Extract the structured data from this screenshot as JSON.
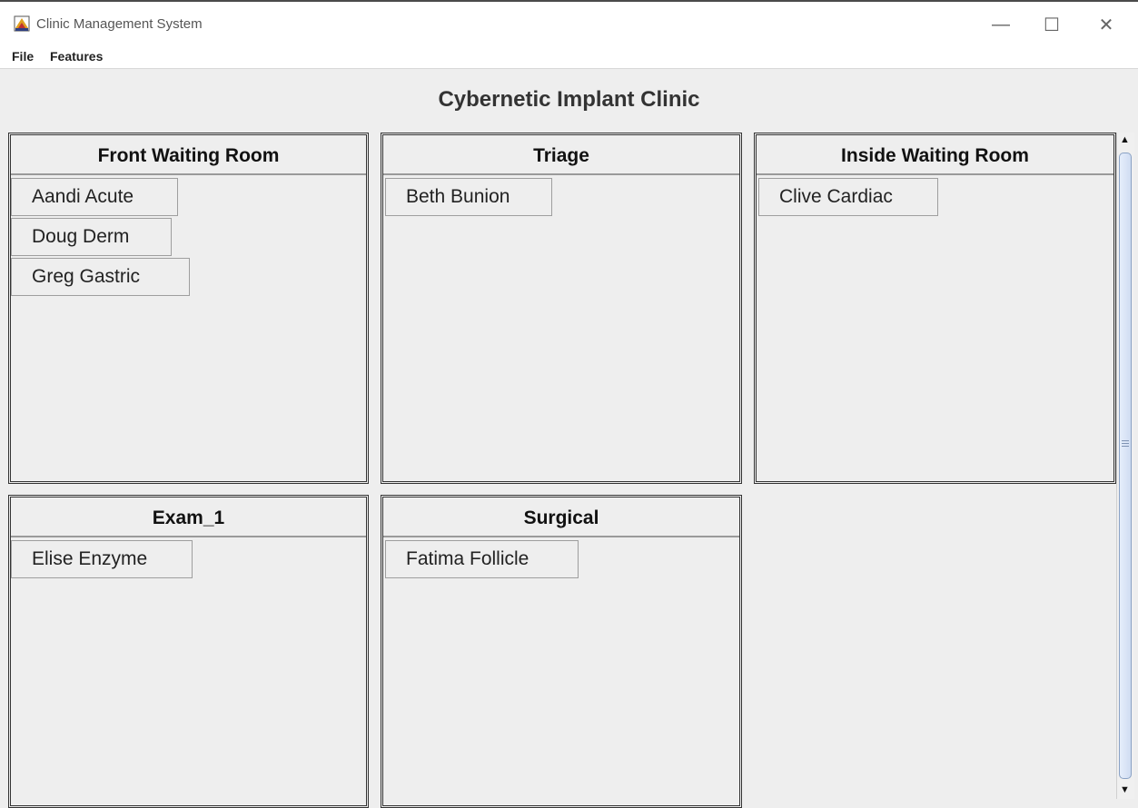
{
  "window": {
    "title": "Clinic Management System",
    "controls": {
      "minimize": "—",
      "maximize": "☐",
      "close": "✕"
    }
  },
  "menu": [
    {
      "label": "File"
    },
    {
      "label": "Features"
    }
  ],
  "clinic": {
    "title": "Cybernetic Implant Clinic"
  },
  "rooms": [
    {
      "name": "Front Waiting Room",
      "patients": [
        "Aandi Acute",
        "Doug Derm",
        "Greg Gastric"
      ]
    },
    {
      "name": "Triage",
      "patients": [
        "Beth Bunion"
      ]
    },
    {
      "name": "Inside Waiting Room",
      "patients": [
        "Clive Cardiac"
      ]
    },
    {
      "name": "Exam_1",
      "patients": [
        "Elise Enzyme"
      ]
    },
    {
      "name": "Surgical",
      "patients": [
        "Fatima Follicle"
      ]
    }
  ],
  "scrollbar": {
    "up_arrow": "▲",
    "down_arrow": "▼"
  },
  "colors": {
    "background": "#eeeeee",
    "border": "#333333",
    "scroll_thumb": "#cfdcf2"
  }
}
